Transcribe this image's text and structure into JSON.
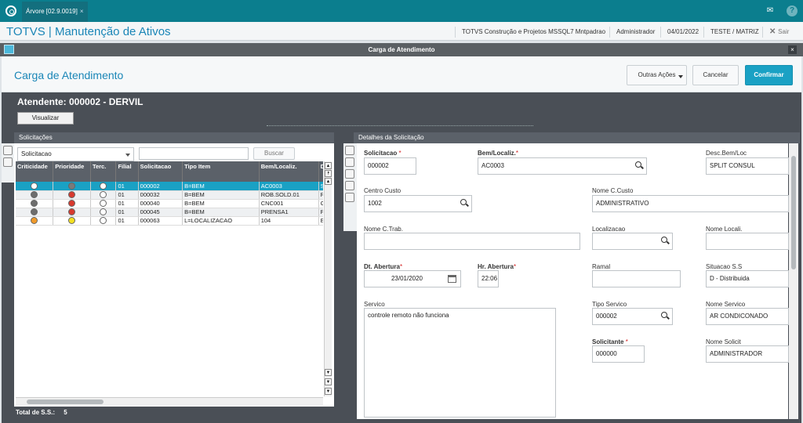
{
  "topbar": {
    "tab_label": "Árvore [02.9.0019]",
    "tab_close": "×"
  },
  "header": {
    "app_title": "TOTVS | Manutenção de Ativos",
    "company": "TOTVS Construção e Projetos MSSQL7 Mntpadrao",
    "user": "Administrador",
    "date": "04/01/2022",
    "env": "TESTE / MATRIZ",
    "exit_label": "Sair"
  },
  "window": {
    "title": "Carga de Atendimento"
  },
  "page": {
    "title": "Carga de Atendimento",
    "other_actions": "Outras Ações",
    "cancel": "Cancelar",
    "confirm": "Confirmar",
    "attendant": "Atendente: 000002 - DERVIL",
    "view_button": "Visualizar"
  },
  "solicitacoes": {
    "panel_title": "Solicitações",
    "filter_value": "Solicitacao",
    "search_value": "",
    "search_button": "Buscar",
    "columns": [
      "Criticidade",
      "Prioridade",
      "Terc.",
      "Filial",
      "Solicitacao",
      "Tipo Item",
      "Bem/Localiz.",
      "D"
    ],
    "rows": [
      {
        "crit": "#ffffff",
        "prio": "#7a7a7a",
        "terc": "#ffffff",
        "filial": "01",
        "sol": "000002",
        "tipo": "B=BEM",
        "bem": "AC0003",
        "d": "S"
      },
      {
        "crit": "#6d6d6d",
        "prio": "#d83a2e",
        "terc": "#ffffff",
        "filial": "01",
        "sol": "000032",
        "tipo": "B=BEM",
        "bem": "ROB.SOLD.01",
        "d": "R"
      },
      {
        "crit": "#6d6d6d",
        "prio": "#d83a2e",
        "terc": "#ffffff",
        "filial": "01",
        "sol": "000040",
        "tipo": "B=BEM",
        "bem": "CNC001",
        "d": "C"
      },
      {
        "crit": "#6d6d6d",
        "prio": "#d83a2e",
        "terc": "#ffffff",
        "filial": "01",
        "sol": "000045",
        "tipo": "B=BEM",
        "bem": "PRENSA1",
        "d": "P"
      },
      {
        "crit": "#f09a2a",
        "prio": "#f3e021",
        "terc": "#ffffff",
        "filial": "01",
        "sol": "000063",
        "tipo": "L=LOCALIZACAO",
        "bem": "104",
        "d": "E"
      }
    ],
    "total_label": "Total de S.S.:",
    "total_value": "5"
  },
  "detalhes": {
    "panel_title": "Detalhes da Solicitação",
    "solicitacao_label": "Solicitacao",
    "solicitacao_value": "000002",
    "bem_label": "Bem/Localiz.",
    "bem_value": "AC0003",
    "descbem_label": "Desc.Bem/Loc",
    "descbem_value": "SPLIT CONSUL",
    "cc_label": "Centro Custo",
    "cc_value": "1002",
    "nomecc_label": "Nome C.Custo",
    "nomecc_value": "ADMINISTRATIVO",
    "nometrab_label": "Nome C.Trab.",
    "nometrab_value": "",
    "local_label": "Localizacao",
    "local_value": "",
    "nomelocal_label": "Nome Locali.",
    "nomelocal_value": "",
    "dtab_label": "Dt. Abertura",
    "dtab_value": "23/01/2020",
    "hrab_label": "Hr. Abertura",
    "hrab_value": "22:06",
    "ramal_label": "Ramal",
    "ramal_value": "",
    "situ_label": "Situacao S.S",
    "situ_value": "D - Distribuida",
    "servico_label": "Servico",
    "servico_value": "controle remoto não funciona",
    "tiposerv_label": "Tipo Servico",
    "tiposerv_value": "000002",
    "nomeserv_label": "Nome Servico",
    "nomeserv_value": "AR CONDICONADO",
    "solicitante_label": "Solicitante",
    "solicitante_value": "000000",
    "nomesolic_label": "Nome Solicit",
    "nomesolic_value": "ADMINISTRADOR"
  }
}
